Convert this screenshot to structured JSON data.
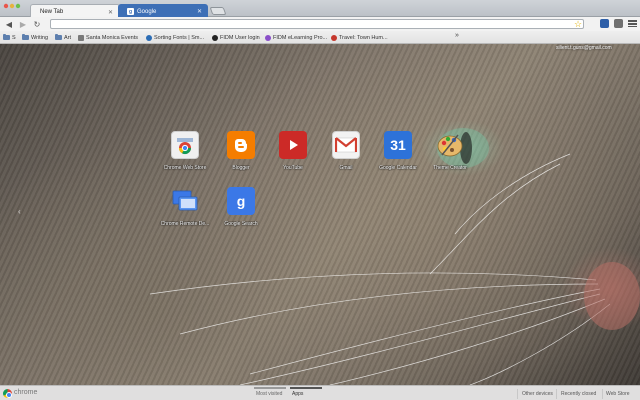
{
  "tabs": [
    {
      "label": "New Tab"
    },
    {
      "label": "Google"
    }
  ],
  "bookmarks": [
    {
      "label": "S"
    },
    {
      "label": "Writing"
    },
    {
      "label": "Art"
    },
    {
      "label": "Santa Monica Events"
    },
    {
      "label": "Sorting Fonts | Sm..."
    },
    {
      "label": "FIDM User login"
    },
    {
      "label": "FIDM eLearning Pro..."
    },
    {
      "label": "Travel: Town Hum..."
    }
  ],
  "account": {
    "email": "silient.t.guns@gmail.com"
  },
  "apps": [
    {
      "label": "Chrome Web Store",
      "icon": "chrome-web-store-icon"
    },
    {
      "label": "Blogger",
      "icon": "blogger-icon"
    },
    {
      "label": "YouTube",
      "icon": "youtube-icon"
    },
    {
      "label": "Gmail",
      "icon": "gmail-icon"
    },
    {
      "label": "Google Calendar",
      "icon": "google-calendar-icon",
      "glyph": "31"
    },
    {
      "label": "Theme Creator",
      "icon": "theme-creator-icon"
    },
    {
      "label": "Chrome Remote De...",
      "icon": "chrome-remote-desktop-icon"
    },
    {
      "label": "Google Search",
      "icon": "google-search-icon",
      "glyph": "g"
    }
  ],
  "footer": {
    "brand": "chrome",
    "tabs": [
      {
        "label": "Most visited"
      },
      {
        "label": "Apps",
        "active": true
      }
    ],
    "links": [
      {
        "label": "Other devices"
      },
      {
        "label": "Recently closed"
      },
      {
        "label": "Web Store"
      }
    ]
  },
  "colors": {
    "tab_google_bg": "#3d6fb6",
    "blogger": "#f57d00",
    "youtube": "#cc2a27",
    "gmail": "#d23f31",
    "calendar": "#2d72d9",
    "search": "#3b78e7"
  }
}
